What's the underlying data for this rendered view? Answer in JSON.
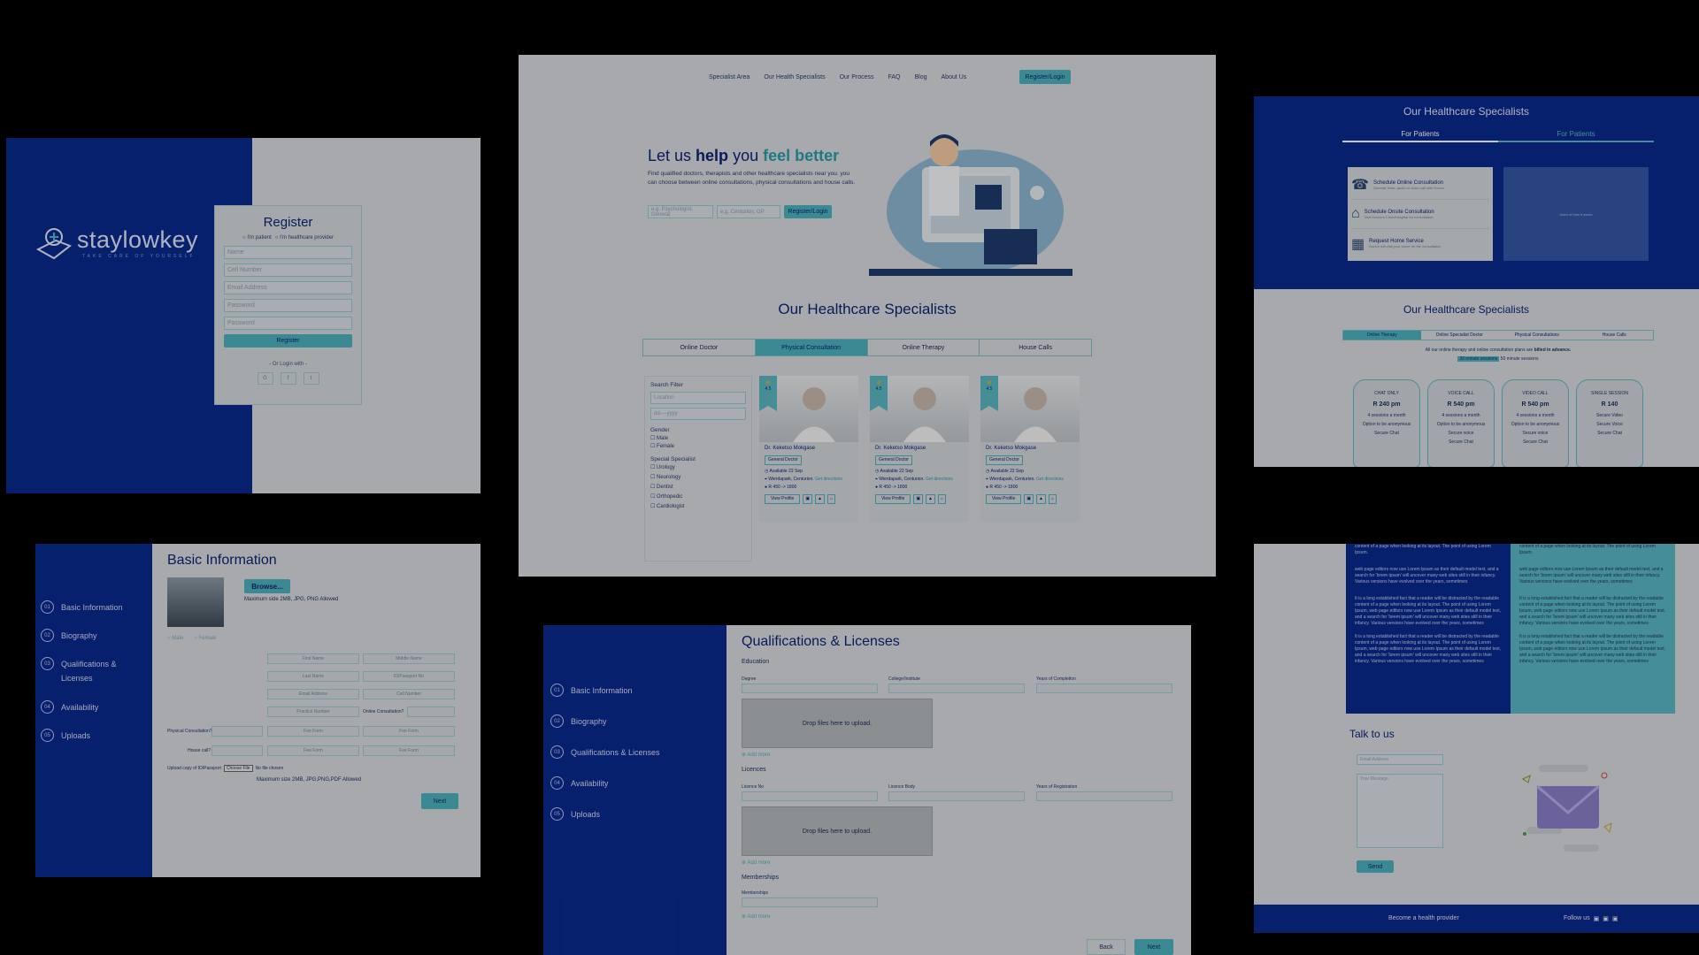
{
  "colors": {
    "navy": "#0a2a8c",
    "teal": "#4cb0bc",
    "light": "#d6d9dd"
  },
  "register": {
    "logo_text": "staylowkey",
    "logo_tagline": "TAKE CARE OF YOURSELF",
    "title": "Register",
    "radio_patient": "I'm patient",
    "radio_provider": "I'm healthcare provider",
    "fields": [
      "Name",
      "Cell Number",
      "Email Address",
      "Password",
      "Password"
    ],
    "submit": "Register",
    "or_login": "- Or Login with -",
    "social_icons": [
      "google-icon",
      "facebook-icon",
      "twitter-icon"
    ]
  },
  "home": {
    "nav": [
      "Specialist Area",
      "Our Health Specialists",
      "Our Process",
      "FAQ",
      "Blog",
      "About Us"
    ],
    "nav_cta": "Register/Login",
    "hero_title_1": "Let us ",
    "hero_title_bold": "help",
    "hero_title_2": " you ",
    "hero_title_accent": "feel better",
    "hero_text": "Find qualified doctors, therapists and other healthcare specialists near you. you can choose between online consultations, physical consultations and house calls.",
    "search1_placeholder": "e.g. Psychologist, General",
    "search2_placeholder": "e.g. Centurion, GP",
    "search_btn": "Register/Login",
    "section_title": "Our Healthcare Specialists",
    "tabs": [
      "Online Doctor",
      "Physical Consultation",
      "Online Therapy",
      "House Calls"
    ],
    "filter": {
      "title": "Search Filter",
      "location": "Location",
      "date": "dd----yyyy",
      "gender_label": "Gender",
      "genders": [
        "Male",
        "Female"
      ],
      "special_label": "Special Specialist",
      "specialists": [
        "Urology",
        "Neurology",
        "Dentist",
        "Orthopedic",
        "Cardiologist"
      ]
    },
    "doctors": [
      {
        "rating": "4.5",
        "name": "Dr. Keketso Mokgase",
        "tag": "General Doctor",
        "available": "Available 22 Sep",
        "location": "Wierdapark, Centurion.",
        "directions": "Get directions",
        "price": "R 450 -> 1800",
        "view": "View Profile"
      },
      {
        "rating": "4.5",
        "name": "Dr. Keketso Mokgase",
        "tag": "General Doctor",
        "available": "Available 22 Sep",
        "location": "Wierdapark, Centurion.",
        "directions": "Get directions",
        "price": "R 450 -> 1800",
        "view": "View Profile"
      },
      {
        "rating": "4.5",
        "name": "Dr. Keketso Mokgase",
        "tag": "General Doctor",
        "available": "Available 22 Sep",
        "location": "Wierdapark, Centurion.",
        "directions": "Get directions",
        "price": "R 450 -> 1800",
        "view": "View Profile"
      }
    ]
  },
  "specialists_top": {
    "title": "Our Healthcare Specialists",
    "tab1": "For Patients",
    "tab2": "For Patients",
    "services": [
      {
        "title": "Schedule Online Consultation",
        "desc": "General Tests, audio or video call with Doctor"
      },
      {
        "title": "Schedule Onsite Consultation",
        "desc": "Visit Doctor's Clinic/Hospital for consultation"
      },
      {
        "title": "Request Home Service",
        "desc": "Doctor will visit your home for the consultation"
      }
    ],
    "video_text": "video of how it works"
  },
  "specialists_bottom": {
    "title": "Our Healthcare Specialists",
    "tabs": [
      "Online Therapy",
      "Online Specialist Doctor",
      "Physical Consultations",
      "House Calls"
    ],
    "note_1": "All our online therapy and online consultation plans are ",
    "note_bold": "billed in advance.",
    "note_2a": "30 minute sessions",
    "note_2b": " 50 minute sessions",
    "plans": [
      {
        "name": "CHAT ONLY",
        "price": "R 240 pm",
        "l1": "4 sessions a month",
        "l2": "Option to be anonymous",
        "l3": "Secure Chat"
      },
      {
        "name": "VOICE CALL",
        "price": "R 540 pm",
        "l1": "4 sessions a month",
        "l2": "Option to be anonymous",
        "l3": "Secure voice",
        "l4": "Secure Chat"
      },
      {
        "name": "VIDEO CALL",
        "price": "R 540 pm",
        "l1": "4 sessions a month",
        "l2": "Option to be anonymous",
        "l3": "Secure voice",
        "l4": "Secure Chat"
      },
      {
        "name": "SINGLE SESSION",
        "price": "R 140",
        "l1": "Secure Video",
        "l2": "Secure Voice",
        "l3": "Secure Chat"
      }
    ]
  },
  "basic": {
    "steps": [
      "Basic Information",
      "Biography",
      "Qualifications & Licenses",
      "Availability",
      "Uploads"
    ],
    "step_nums": [
      "01",
      "02",
      "03",
      "04",
      "05"
    ],
    "title": "Basic Information",
    "browse": "Browse...",
    "max_size": "Maximum side 2MB, JPG, PNG Allowed",
    "gender": [
      "Male",
      "Female"
    ],
    "fields_row1": [
      "First Name",
      "Middle Name"
    ],
    "fields_row2": [
      "Last Name",
      "ID/Passport No"
    ],
    "fields_row3": [
      "Email Address",
      "Cell Number"
    ],
    "fields_row4": "Practice Number",
    "online_label": "Online Consultation?",
    "physical_label": "Physical Consultation?",
    "house_label": "House call?",
    "fee": "Fee Form",
    "upload_label": "Upload copy of ID/Passport",
    "choose": "Choose File",
    "no_file": "No file chosen",
    "max_upload": "Maximum size 2MB, JPG,PNG,PDF Allowed",
    "next": "Next"
  },
  "qual": {
    "title": "Qualifications & Licenses",
    "education": "Education",
    "edu_fields": [
      "Degree",
      "College/Institute",
      "Years of Completion"
    ],
    "drop": "Drop files here to upload.",
    "add_more": "Add more",
    "licences": "Licences",
    "lic_fields": [
      "Licence No",
      "Licence Body",
      "Years of Registration"
    ],
    "memberships": "Memberships",
    "mem_field": "Memberships",
    "back": "Back",
    "next": "Next"
  },
  "contact": {
    "lorem_a": "content of a page when looking at its layout. The point of using Lorem Ipsum.",
    "lorem_b": "web page editors now use Lorem Ipsum as their default model text, and a search for 'lorem ipsum' will uncover many web sites still in their infancy. Various versions have evolved over the years, sometimes",
    "lorem_c": "It is a long established fact that a reader will be distracted by the readable content of a page when looking at its layout. The point of using Lorem Ipsum, web page editors now use Lorem Ipsum as their default model text, and a search for 'lorem ipsum' will uncover many web sites still in their infancy. Various versions have evolved over the years, sometimes",
    "talk_title": "Talk to us",
    "email_placeholder": "Email Address",
    "message_placeholder": "Your Message",
    "send": "Send",
    "footer_left": "Become a health provider",
    "footer_right": "Follow us"
  }
}
